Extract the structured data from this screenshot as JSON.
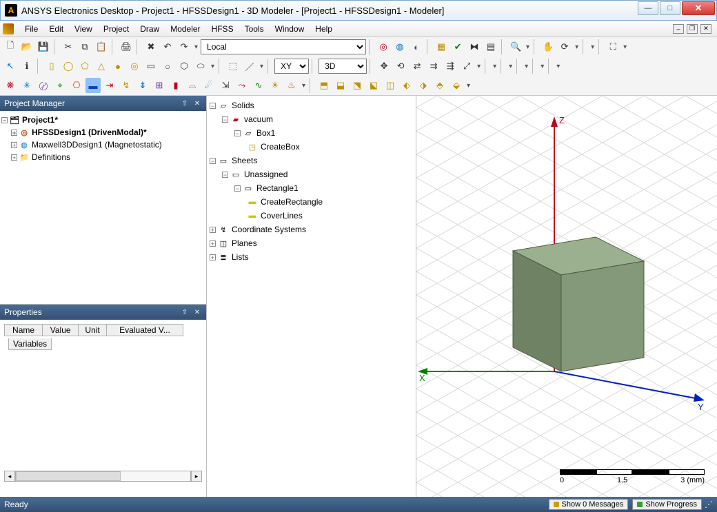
{
  "window": {
    "title": "ANSYS Electronics Desktop - Project1 - HFSSDesign1 - 3D Modeler - [Project1 - HFSSDesign1 - Modeler]"
  },
  "menu": {
    "file": "File",
    "edit": "Edit",
    "view": "View",
    "project": "Project",
    "draw": "Draw",
    "modeler": "Modeler",
    "hfss": "HFSS",
    "tools": "Tools",
    "window": "Window",
    "help": "Help"
  },
  "toolbar": {
    "coord_system": "Local",
    "plane": "XY",
    "mode3d": "3D"
  },
  "project_manager": {
    "title": "Project Manager",
    "project": "Project1*",
    "design_hfss": "HFSSDesign1 (DrivenModal)*",
    "design_maxwell": "Maxwell3DDesign1 (Magnetostatic)",
    "definitions": "Definitions"
  },
  "properties": {
    "title": "Properties",
    "cols": {
      "name": "Name",
      "value": "Value",
      "unit": "Unit",
      "eval": "Evaluated V..."
    },
    "tab": "Variables"
  },
  "model_tree": {
    "solids": "Solids",
    "vacuum": "vacuum",
    "box1": "Box1",
    "createbox": "CreateBox",
    "sheets": "Sheets",
    "unassigned": "Unassigned",
    "rect1": "Rectangle1",
    "createrect": "CreateRectangle",
    "coverlines": "CoverLines",
    "coords": "Coordinate Systems",
    "planes": "Planes",
    "lists": "Lists"
  },
  "viewport": {
    "axis_x": "X",
    "axis_y": "Y",
    "axis_z": "Z",
    "scale": {
      "start": "0",
      "mid": "1.5",
      "end": "3 (mm)"
    }
  },
  "status": {
    "ready": "Ready",
    "messages": "Show 0 Messages",
    "progress": "Show Progress"
  }
}
